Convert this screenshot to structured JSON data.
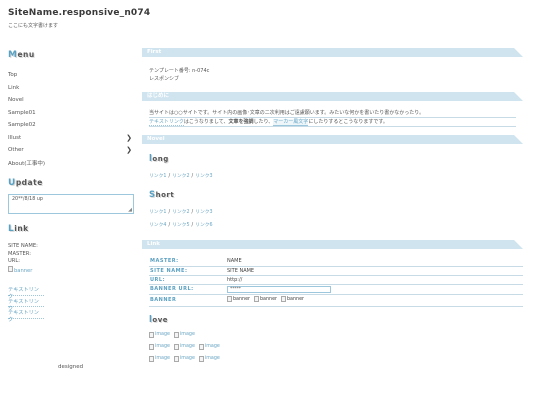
{
  "header": {
    "site_title": "SiteName.responsive_n074",
    "site_sub": "ここにも文字書けます"
  },
  "sidebar": {
    "menu_heading_cap": "M",
    "menu_heading_rest": "enu",
    "menu_items": [
      {
        "label": "Top"
      },
      {
        "label": "Link"
      },
      {
        "label": "Novel"
      },
      {
        "label": "Sample01"
      },
      {
        "label": "Sample02"
      },
      {
        "label": "Illust",
        "arrow": "❯"
      },
      {
        "label": "Other",
        "arrow": "❯"
      },
      {
        "label": "About(工事中)"
      }
    ],
    "update_heading_cap": "U",
    "update_heading_rest": "pdate",
    "update_text": "20**/8/18 up",
    "link_heading_cap": "L",
    "link_heading_rest": "ink",
    "site_name_label": "SITE NAME:",
    "master_label": "MASTER:",
    "url_label": "URL:",
    "banner_alt": "banner",
    "text_links": [
      "テキストリンク",
      "テキストリンク",
      "テキストリンク"
    ],
    "designed": "designed"
  },
  "main": {
    "first_bar": "First",
    "template_no": "テンプレート番号: n-074c",
    "responsive": "レスポンシブ",
    "intro_bar": "はじめに",
    "intro_line1": "当サイトは○○サイトです。サイト内の画像･文章の二次利用はご遠慮願います。みたいな何かを書いたり書かなかったり。",
    "intro_link": "テキストリンク",
    "intro_mid": "はこうなりまして、",
    "intro_bold": "文章を強調",
    "intro_after_bold": "したり、",
    "intro_marker": "マーカー風文字",
    "intro_end": "にしたりするとこうなりますです。",
    "novel_bar": "Novel",
    "long_cap": "l",
    "long_rest": "ong",
    "long_links": [
      "リンク1",
      "リンク2",
      "リンク3"
    ],
    "short_cap": "S",
    "short_rest": "hort",
    "short_links_row1": [
      "リンク1",
      "リンク2",
      "リンク3"
    ],
    "short_links_row2": [
      "リンク4",
      "リンク5",
      "リンク6"
    ],
    "link_bar": "Link",
    "table": {
      "master_k": "MASTER:",
      "master_v": "NAME",
      "sitename_k": "SITE NAME:",
      "sitename_v": "SITE NAME",
      "url_k": "URL:",
      "url_v": "http://",
      "bannerurl_k": "BANNER URL:",
      "bannerurl_v": "*****",
      "banner_k": "BANNER",
      "banner_alt": "banner"
    },
    "love_cap": "l",
    "love_rest": "ove",
    "image_alt": "image"
  }
}
